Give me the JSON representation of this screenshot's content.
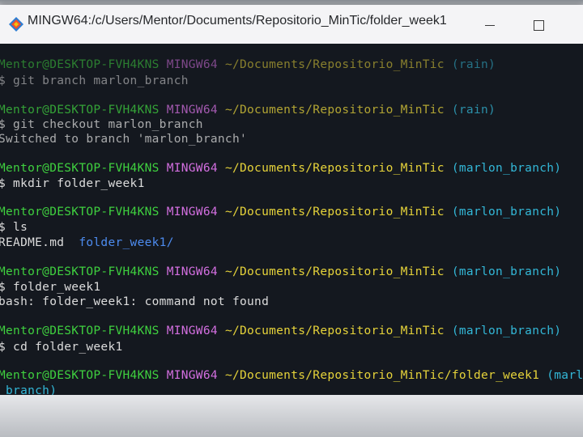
{
  "window": {
    "title": "MINGW64:/c/Users/Mentor/Documents/Repositorio_MinTic/folder_week1"
  },
  "colors": {
    "user": "#3fd13f",
    "host": "#d36fe0",
    "path": "#e6d33a",
    "branch": "#33b8d8",
    "directory": "#4d8cf0",
    "background": "#14181f"
  },
  "terminal": {
    "p1": {
      "user": "Mentor@DESKTOP-FVH4KNS",
      "host": "MINGW64",
      "path": "~/Documents/Repositorio_MinTic",
      "branch": "(rain)"
    },
    "c1": "$ git branch marlon_branch",
    "p2": {
      "user": "Mentor@DESKTOP-FVH4KNS",
      "host": "MINGW64",
      "path": "~/Documents/Repositorio_MinTic",
      "branch": "(rain)"
    },
    "c2": "$ git checkout marlon_branch",
    "o2": "Switched to branch 'marlon_branch'",
    "p3": {
      "user": "Mentor@DESKTOP-FVH4KNS",
      "host": "MINGW64",
      "path": "~/Documents/Repositorio_MinTic",
      "branch": "(marlon_branch)"
    },
    "c3": "$ mkdir folder_week1",
    "p4": {
      "user": "Mentor@DESKTOP-FVH4KNS",
      "host": "MINGW64",
      "path": "~/Documents/Repositorio_MinTic",
      "branch": "(marlon_branch)"
    },
    "c4": "$ ls",
    "o4_file": "README.md",
    "o4_dir": "folder_week1/",
    "p5": {
      "user": "Mentor@DESKTOP-FVH4KNS",
      "host": "MINGW64",
      "path": "~/Documents/Repositorio_MinTic",
      "branch": "(marlon_branch)"
    },
    "c5": "$ folder_week1",
    "o5": "bash: folder_week1: command not found",
    "p6": {
      "user": "Mentor@DESKTOP-FVH4KNS",
      "host": "MINGW64",
      "path": "~/Documents/Repositorio_MinTic",
      "branch": "(marlon_branch)"
    },
    "c6": "$ cd folder_week1",
    "p7": {
      "user": "Mentor@DESKTOP-FVH4KNS",
      "host": "MINGW64",
      "path": "~/Documents/Repositorio_MinTic/folder_week1",
      "branch": "(marl",
      "branch_wrap": "_branch)"
    }
  }
}
